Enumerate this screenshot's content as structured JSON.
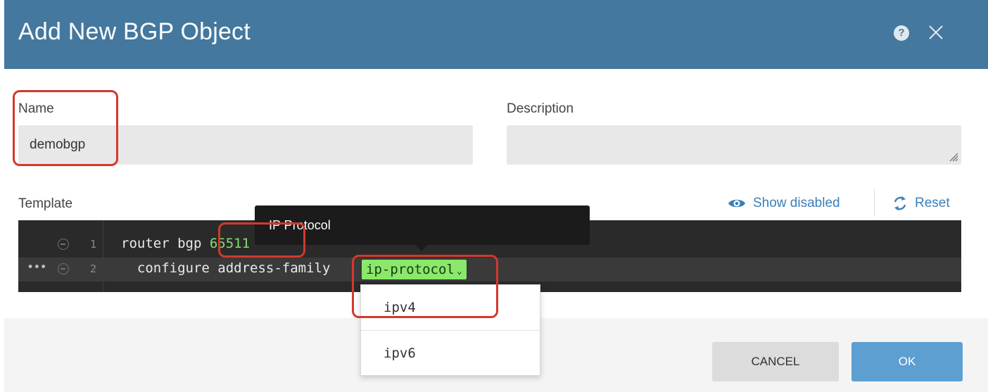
{
  "dialog": {
    "title": "Add New BGP Object",
    "help_icon": "help-circle-icon",
    "close_icon": "close-icon"
  },
  "form": {
    "name_label": "Name",
    "name_value": "demobgp",
    "description_label": "Description",
    "description_value": ""
  },
  "template": {
    "label": "Template",
    "show_disabled_label": "Show disabled",
    "reset_label": "Reset",
    "lines": [
      {
        "number": "1",
        "text": "router bgp ",
        "value": "65511"
      },
      {
        "number": "2",
        "text": "  configure address-family ",
        "token": "ip-protocol"
      }
    ]
  },
  "tooltip": {
    "text": "IP Protocol"
  },
  "dropdown": {
    "options": [
      "ipv4",
      "ipv6"
    ]
  },
  "footer": {
    "cancel_label": "CANCEL",
    "ok_label": "OK"
  },
  "colors": {
    "header_bg": "#44789e",
    "ok_button": "#5d9fd1",
    "annotation_red": "#d3392c",
    "token_green": "#8ae86a"
  }
}
